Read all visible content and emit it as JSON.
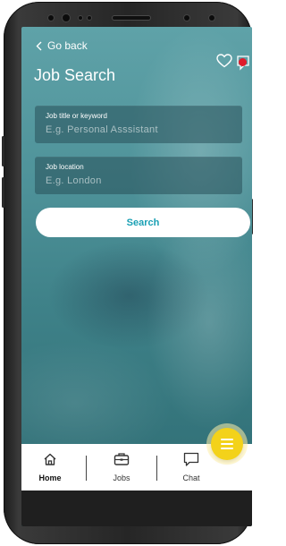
{
  "header": {
    "back_label": "Go back",
    "title": "Job Search"
  },
  "form": {
    "keyword": {
      "label": "Job title or keyword",
      "placeholder": "E.g. Personal Asssistant",
      "value": ""
    },
    "location": {
      "label": "Job location",
      "placeholder": "E.g. London",
      "value": ""
    },
    "search_label": "Search"
  },
  "tabs": [
    {
      "label": "Home",
      "icon": "home-icon",
      "active": true
    },
    {
      "label": "Jobs",
      "icon": "briefcase-icon",
      "active": false
    },
    {
      "label": "Chat",
      "icon": "chat-icon",
      "active": false
    }
  ],
  "colors": {
    "accent": "#1aa0b4",
    "fab": "#f3d21a",
    "notification": "#e01b2b"
  }
}
